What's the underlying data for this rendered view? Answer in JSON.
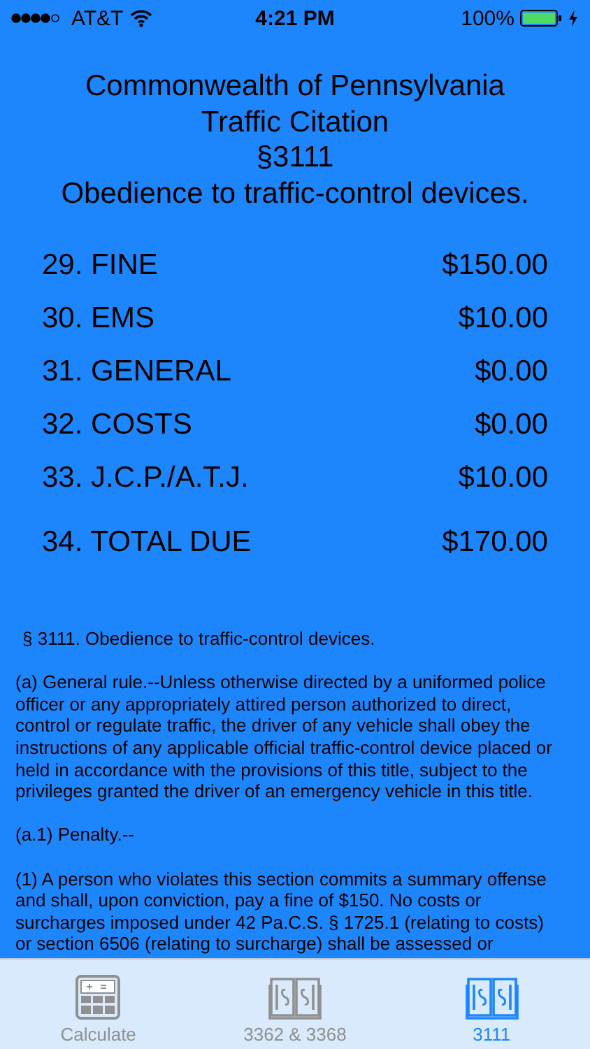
{
  "status_bar": {
    "carrier": "AT&T",
    "time": "4:21 PM",
    "battery": "100%",
    "charging": true
  },
  "header": {
    "lines": [
      "Commonwealth of Pennsylvania",
      "Traffic Citation",
      "§3111",
      "Obedience to traffic-control devices."
    ]
  },
  "fees": [
    {
      "label": "29. FINE",
      "amount": "$150.00",
      "kind": "item"
    },
    {
      "label": "30. EMS",
      "amount": "$10.00",
      "kind": "item"
    },
    {
      "label": "31. GENERAL",
      "amount": "$0.00",
      "kind": "item"
    },
    {
      "label": "32. COSTS",
      "amount": "$0.00",
      "kind": "item"
    },
    {
      "label": "33. J.C.P./A.T.J.",
      "amount": "$10.00",
      "kind": "item"
    },
    {
      "label": "34. TOTAL DUE",
      "amount": "$170.00",
      "kind": "total"
    }
  ],
  "statute": [
    "§ 3111.  Obedience to traffic-control devices.",
    "(a)  General rule.--Unless otherwise directed by a uniformed police officer or any appropriately attired person authorized to direct, control or regulate traffic, the driver of any vehicle shall obey the instructions of any applicable official traffic-control device placed or held in accordance with the provisions of this title, subject to the privileges granted the driver of an emergency vehicle in this title.",
    "(a.1)  Penalty.--",
    "(1)  A person who violates this section commits a summary offense and shall, upon conviction, pay a fine of $150. No costs or surcharges imposed under 42 Pa.C.S. § 1725.1 (relating to costs) or section 6506 (relating to surcharge) shall be assessed or"
  ],
  "tab_bar": [
    {
      "label": "Calculate",
      "kind": "calculator",
      "selected": false
    },
    {
      "label": "3362 & 3368",
      "kind": "book",
      "selected": false
    },
    {
      "label": "3111",
      "kind": "book",
      "selected": true
    }
  ]
}
